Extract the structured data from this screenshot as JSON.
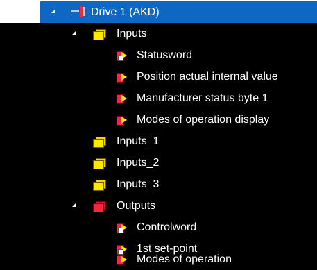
{
  "tree": {
    "root": {
      "label": "Drive 1 (AKD)",
      "expanded": true,
      "selected": true,
      "icon": "drive-device-icon"
    },
    "inputs": {
      "label": "Inputs",
      "expanded": true,
      "icon": "input-folder-icon",
      "items": [
        {
          "label": "Statusword",
          "icon": "input-variable-icon"
        },
        {
          "label": "Position actual internal value",
          "icon": "input-variable-icon"
        },
        {
          "label": "Manufacturer status byte 1",
          "icon": "input-variable-icon"
        },
        {
          "label": "Modes of operation display",
          "icon": "input-variable-icon"
        }
      ]
    },
    "inputs_1": {
      "label": "Inputs_1",
      "icon": "input-folder-icon"
    },
    "inputs_2": {
      "label": "Inputs_2",
      "icon": "input-folder-icon"
    },
    "inputs_3": {
      "label": "Inputs_3",
      "icon": "input-folder-icon"
    },
    "outputs": {
      "label": "Outputs",
      "expanded": true,
      "icon": "output-folder-icon",
      "items": [
        {
          "label": "Controlword",
          "icon": "output-variable-icon"
        },
        {
          "label": "1st set-point",
          "icon": "output-variable-icon"
        },
        {
          "label": "Modes of operation",
          "icon": "output-variable-icon"
        }
      ]
    }
  },
  "colors": {
    "background": "#000000",
    "selection": "#0e68c3",
    "text": "#ffffff",
    "input_folder": "#ffe800",
    "output_folder": "#f0293f"
  }
}
